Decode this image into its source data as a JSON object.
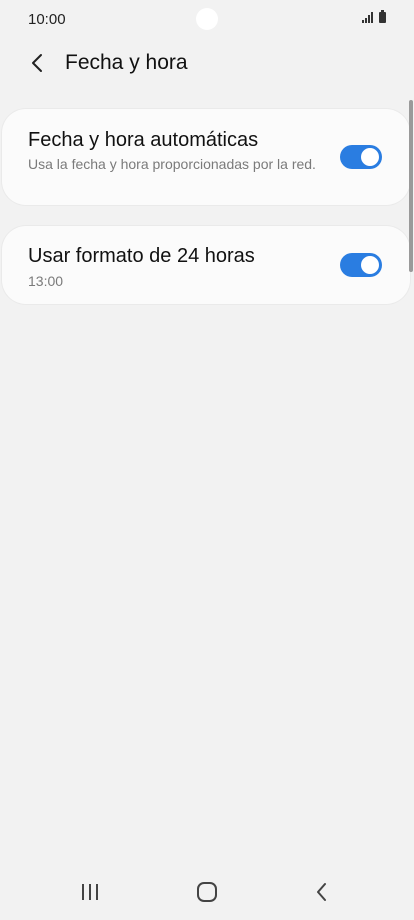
{
  "status_bar": {
    "time": "10:00",
    "icons": [
      "signal-icon",
      "battery-icon"
    ]
  },
  "header": {
    "back_icon": "chevron-left-icon",
    "title": "Fecha y hora"
  },
  "settings": {
    "items": [
      {
        "title": "Fecha y hora automáticas",
        "subtitle": "Usa la fecha y hora proporcionadas por la red.",
        "toggle_on": true
      },
      {
        "title": "Usar formato de 24 horas",
        "subtitle": "13:00",
        "toggle_on": true
      }
    ]
  },
  "colors": {
    "accent": "#2a7de1",
    "background": "#f2f2f2",
    "card": "#fbfbfb"
  },
  "nav_bar": {
    "icons": [
      "recents-icon",
      "home-icon",
      "back-icon"
    ]
  }
}
